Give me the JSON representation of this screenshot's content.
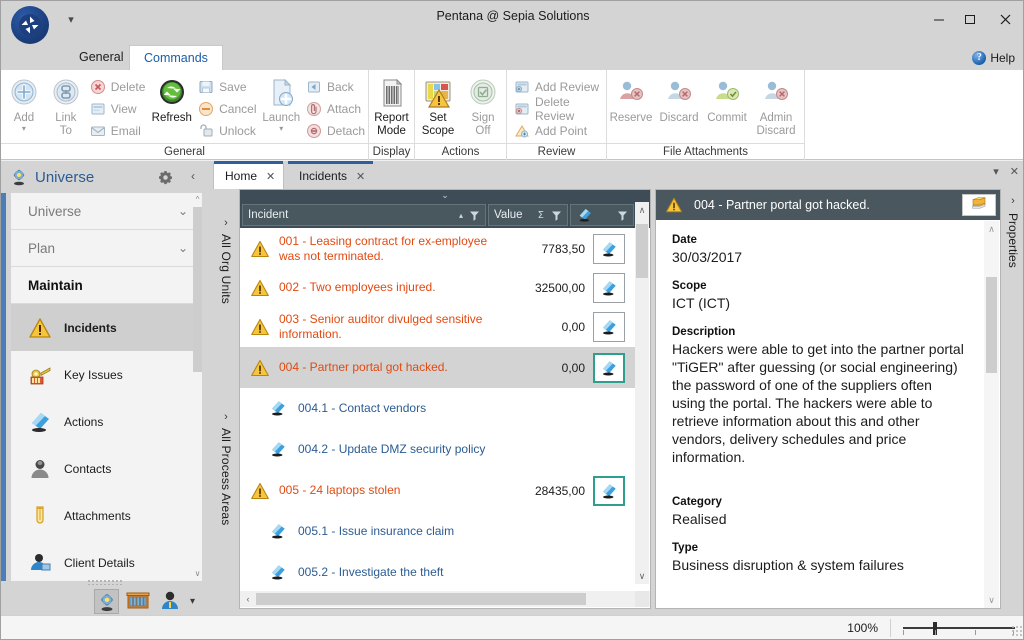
{
  "window": {
    "title": "Pentana @ Sepia Solutions",
    "minimize": "─",
    "maximize": "□",
    "close": "✕",
    "qat_caret": "▾"
  },
  "ribbon": {
    "tabs": [
      {
        "label": "General",
        "active": false
      },
      {
        "label": "Commands",
        "active": true
      }
    ],
    "help_label": "Help",
    "help_glyph": "?",
    "groups": [
      {
        "title": "General",
        "big": [
          {
            "label": "Add",
            "icon": "add-icon",
            "enabled": false,
            "dropdown": true
          },
          {
            "label": "Link\nTo",
            "icon": "link-to-icon",
            "enabled": false,
            "dropdown": true
          },
          {
            "label": "Refresh",
            "icon": "refresh-icon",
            "enabled": true,
            "dropdown": false
          },
          {
            "label": "Launch",
            "icon": "launch-icon",
            "enabled": false,
            "dropdown": true
          }
        ],
        "small_groups": [
          [
            {
              "label": "Delete",
              "icon": "delete-icon",
              "enabled": false
            },
            {
              "label": "View",
              "icon": "view-icon",
              "enabled": false
            },
            {
              "label": "Email",
              "icon": "email-icon",
              "enabled": false
            }
          ],
          [
            {
              "label": "Save",
              "icon": "save-icon",
              "enabled": false
            },
            {
              "label": "Cancel",
              "icon": "cancel-icon",
              "enabled": false
            },
            {
              "label": "Unlock",
              "icon": "unlock-icon",
              "enabled": false
            }
          ],
          [
            {
              "label": "Back",
              "icon": "back-icon",
              "enabled": false
            },
            {
              "label": "Attach",
              "icon": "attach-icon",
              "enabled": false
            },
            {
              "label": "Detach",
              "icon": "detach-icon",
              "enabled": false
            }
          ]
        ]
      },
      {
        "title": "Display",
        "big": [
          {
            "label": "Report\nMode",
            "icon": "report-mode-icon",
            "enabled": true,
            "dropdown": false
          }
        ]
      },
      {
        "title": "Actions",
        "big": [
          {
            "label": "Set\nScope",
            "icon": "set-scope-icon",
            "enabled": true,
            "dropdown": false
          },
          {
            "label": "Sign\nOff",
            "icon": "sign-off-icon",
            "enabled": false,
            "dropdown": true
          }
        ]
      },
      {
        "title": "Review",
        "small_groups": [
          [
            {
              "label": "Add Review",
              "icon": "add-review-icon",
              "enabled": false
            },
            {
              "label": "Delete Review",
              "icon": "delete-review-icon",
              "enabled": false
            },
            {
              "label": "Add Point",
              "icon": "add-point-icon",
              "enabled": false
            }
          ]
        ]
      },
      {
        "title": "File Attachments",
        "big": [
          {
            "label": "Reserve",
            "icon": "reserve-icon",
            "enabled": false,
            "dropdown": false
          },
          {
            "label": "Discard",
            "icon": "discard-icon",
            "enabled": false,
            "dropdown": false
          },
          {
            "label": "Commit",
            "icon": "commit-icon",
            "enabled": false,
            "dropdown": false
          },
          {
            "label": "Admin\nDiscard",
            "icon": "admin-discard-icon",
            "enabled": false,
            "dropdown": false
          }
        ]
      }
    ]
  },
  "sidebar": {
    "title": "Universe",
    "gear_icon": "gear-icon",
    "collapse_glyph": "‹",
    "groups": [
      {
        "label": "Universe",
        "expanded": false,
        "chevron": "⌄"
      },
      {
        "label": "Plan",
        "expanded": false,
        "chevron": "⌄"
      },
      {
        "label": "Maintain",
        "expanded": true,
        "chevron": ""
      }
    ],
    "items": [
      {
        "label": "Incidents",
        "icon": "incident-warning-icon",
        "selected": true
      },
      {
        "label": "Key Issues",
        "icon": "key-issues-icon",
        "selected": false
      },
      {
        "label": "Actions",
        "icon": "action-icon",
        "selected": false
      },
      {
        "label": "Contacts",
        "icon": "contacts-icon",
        "selected": false
      },
      {
        "label": "Attachments",
        "icon": "attachments-icon",
        "selected": false
      },
      {
        "label": "Client Details",
        "icon": "client-details-icon",
        "selected": false
      }
    ],
    "footer_icons": [
      "universe-icon",
      "library-icon",
      "user-icon"
    ],
    "footer_caret": "▾"
  },
  "main": {
    "tabs": [
      {
        "label": "Home",
        "active": true,
        "close": "✕"
      },
      {
        "label": "Incidents",
        "active": false,
        "close": "✕"
      }
    ],
    "tab_right": {
      "dropdown": "▾",
      "close": "✕"
    },
    "vertical_tabs": [
      {
        "label": "All Org Units",
        "chevron": "›"
      },
      {
        "label": "All Process Areas",
        "chevron": "›"
      }
    ],
    "grid": {
      "collapse_glyph": "⌄",
      "columns": [
        {
          "label": "Incident",
          "sort": "▴",
          "filter": "filter-icon"
        },
        {
          "label": "Value",
          "aggregate": "Σ",
          "filter": "filter-icon"
        },
        {
          "label": "",
          "icon": "action-icon",
          "filter": "filter-icon"
        }
      ],
      "rows": [
        {
          "type": "incident",
          "icon": "incident-warning-icon",
          "text": "001 - Leasing contract for ex-employee was not terminated.",
          "value": "7783,50",
          "button_icon": "action-icon",
          "highlighted": false,
          "selected": false
        },
        {
          "type": "incident",
          "icon": "incident-warning-icon",
          "text": "002 - Two employees injured.",
          "value": "32500,00",
          "button_icon": "action-icon",
          "highlighted": false,
          "selected": false
        },
        {
          "type": "incident",
          "icon": "incident-warning-icon",
          "text": "003 - Senior auditor divulged sensitive information.",
          "value": "0,00",
          "button_icon": "action-icon",
          "highlighted": false,
          "selected": false
        },
        {
          "type": "incident",
          "icon": "incident-warning-icon",
          "text": "004 - Partner portal got hacked.",
          "value": "0,00",
          "button_icon": "action-icon",
          "highlighted": true,
          "selected": true
        },
        {
          "type": "action",
          "icon": "action-icon",
          "text": "004.1 - Contact vendors",
          "value": "",
          "button_icon": "",
          "highlighted": false,
          "selected": false
        },
        {
          "type": "action",
          "icon": "action-icon",
          "text": "004.2 - Update DMZ security policy",
          "value": "",
          "button_icon": "",
          "highlighted": false,
          "selected": false
        },
        {
          "type": "incident",
          "icon": "incident-warning-icon",
          "text": "005 - 24 laptops stolen",
          "value": "28435,00",
          "button_icon": "action-icon",
          "highlighted": true,
          "selected": false
        },
        {
          "type": "action",
          "icon": "action-icon",
          "text": "005.1 - Issue insurance claim",
          "value": "",
          "button_icon": "",
          "highlighted": false,
          "selected": false
        },
        {
          "type": "action",
          "icon": "action-icon",
          "text": "005.2 - Investigate the theft",
          "value": "",
          "button_icon": "",
          "highlighted": false,
          "selected": false
        }
      ],
      "scroll_up": "∧",
      "scroll_down": "∨",
      "scroll_left": "‹",
      "scroll_right": "›"
    },
    "details": {
      "header_icon": "incident-warning-icon",
      "header_title": "004 - Partner portal got hacked.",
      "header_button_icon": "book-icon",
      "fields": [
        {
          "label": "Date",
          "value": "30/03/2017"
        },
        {
          "label": "Scope",
          "value": "ICT (ICT)"
        },
        {
          "label": "Description",
          "value": "Hackers were able to get into the partner portal \"TiGER\" after guessing (or social engineering) the password of one of the suppliers often using the portal. The hackers were able to retrieve information about this and other vendors, delivery schedules and price information."
        },
        {
          "label": "Category",
          "value": "Realised"
        },
        {
          "label": "Type",
          "value": "Business disruption & system failures"
        }
      ],
      "properties_tab": {
        "label": "Properties",
        "chevron": "›"
      }
    }
  },
  "statusbar": {
    "zoom_level": "100%"
  },
  "colors": {
    "accent_blue": "#2f5e9e",
    "header_dark": "#3d4c56",
    "incident_text": "#e14a12",
    "action_text": "#2b5c93",
    "selection_teal": "#2e9e8f",
    "titlebar": "#d4d4d4"
  }
}
